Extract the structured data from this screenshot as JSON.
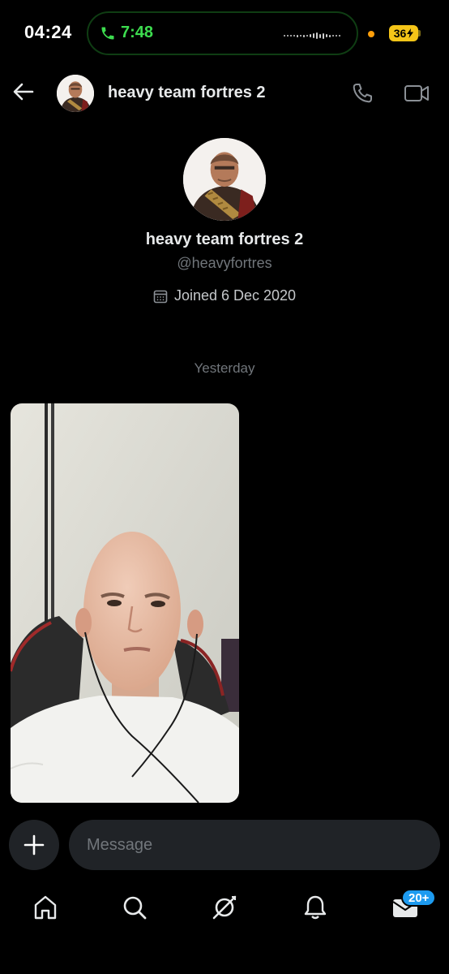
{
  "status_bar": {
    "time": "04:24",
    "call_duration": "7:48",
    "battery_level": "36",
    "icons": [
      "phone-icon",
      "waveform-icon",
      "orange-privacy-dot",
      "battery-icon"
    ]
  },
  "header": {
    "title": "heavy team fortres 2",
    "icons": [
      "back-arrow-icon",
      "phone-icon",
      "video-camera-icon"
    ]
  },
  "profile": {
    "name": "heavy team fortres 2",
    "handle": "@heavyfortres",
    "joined": "Joined 6 Dec 2020"
  },
  "conversation": {
    "date_separator": "Yesterday",
    "messages": [
      {
        "type": "photo",
        "description_icon": "photo-message"
      }
    ]
  },
  "composer": {
    "placeholder": "Message",
    "add_icon": "plus-icon"
  },
  "tab_bar": {
    "tabs": [
      {
        "name": "home",
        "icon": "home-icon"
      },
      {
        "name": "search",
        "icon": "search-icon"
      },
      {
        "name": "grok",
        "icon": "grok-icon"
      },
      {
        "name": "notifications",
        "icon": "bell-icon"
      },
      {
        "name": "messages",
        "icon": "mail-icon",
        "badge": "20+"
      }
    ]
  },
  "colors": {
    "background": "#000000",
    "text_primary": "#e7e9ea",
    "text_secondary": "#71767b",
    "accent": "#1d9bf0",
    "call_green": "#3ddc4f",
    "battery": "#f5c518",
    "input_bg": "#202327"
  }
}
